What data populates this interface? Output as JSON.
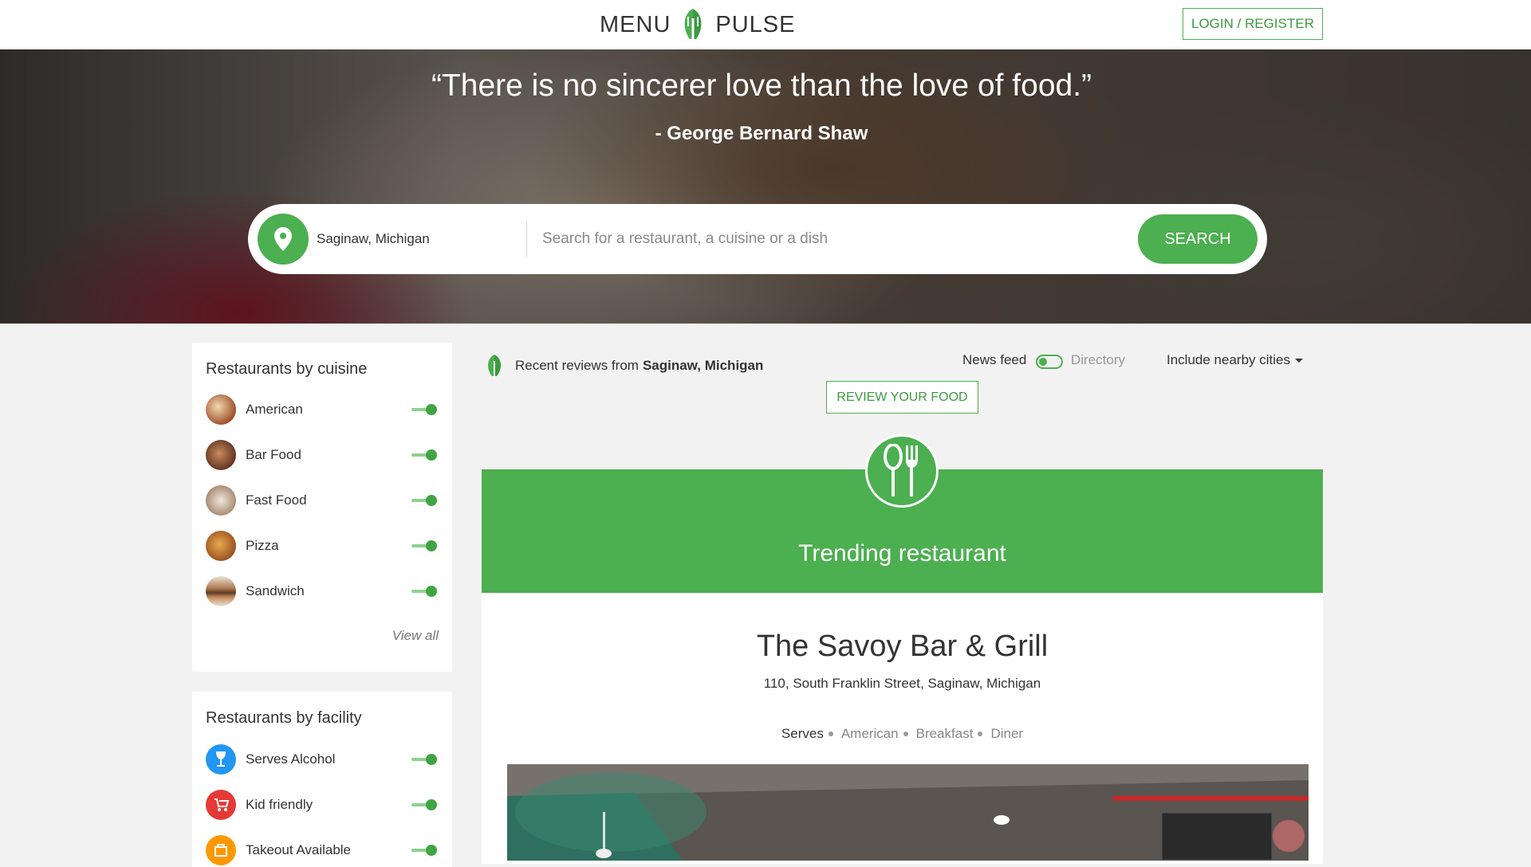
{
  "header": {
    "logo_left": "MENU",
    "logo_right": "PULSE",
    "login_label": "LOGIN / REGISTER"
  },
  "hero": {
    "quote": "“There is no sincerer love than the love of food.”",
    "author": "- George Bernard Shaw",
    "location": "Saginaw, Michigan",
    "search_placeholder": "Search for a restaurant, a cuisine or a dish",
    "search_label": "SEARCH"
  },
  "sidebar": {
    "cuisine_title": "Restaurants by cuisine",
    "cuisines": [
      {
        "label": "American",
        "enabled": true
      },
      {
        "label": "Bar Food",
        "enabled": true
      },
      {
        "label": "Fast Food",
        "enabled": true
      },
      {
        "label": "Pizza",
        "enabled": true
      },
      {
        "label": "Sandwich",
        "enabled": true
      }
    ],
    "view_all": "View all",
    "facility_title": "Restaurants by facility",
    "facilities": [
      {
        "label": "Serves Alcohol",
        "enabled": true,
        "color": "#2196f3"
      },
      {
        "label": "Kid friendly",
        "enabled": true,
        "color": "#e53935"
      },
      {
        "label": "Takeout Available",
        "enabled": true,
        "color": "#ff9800"
      }
    ]
  },
  "feed": {
    "recent_prefix": "Recent reviews from",
    "recent_city": "Saginaw, Michigan",
    "news_feed": "News feed",
    "directory": "Directory",
    "nearby": "Include nearby cities",
    "review_btn": "REVIEW YOUR FOOD",
    "trending_label": "Trending restaurant",
    "restaurant": {
      "name": "The Savoy Bar & Grill",
      "address": "110, South Franklin Street, Saginaw, Michigan",
      "serves_label": "Serves",
      "tags": [
        "American",
        "Breakfast",
        "Diner"
      ]
    }
  },
  "colors": {
    "brand_green": "#4caf50",
    "toggle_green": "#3fa442"
  }
}
